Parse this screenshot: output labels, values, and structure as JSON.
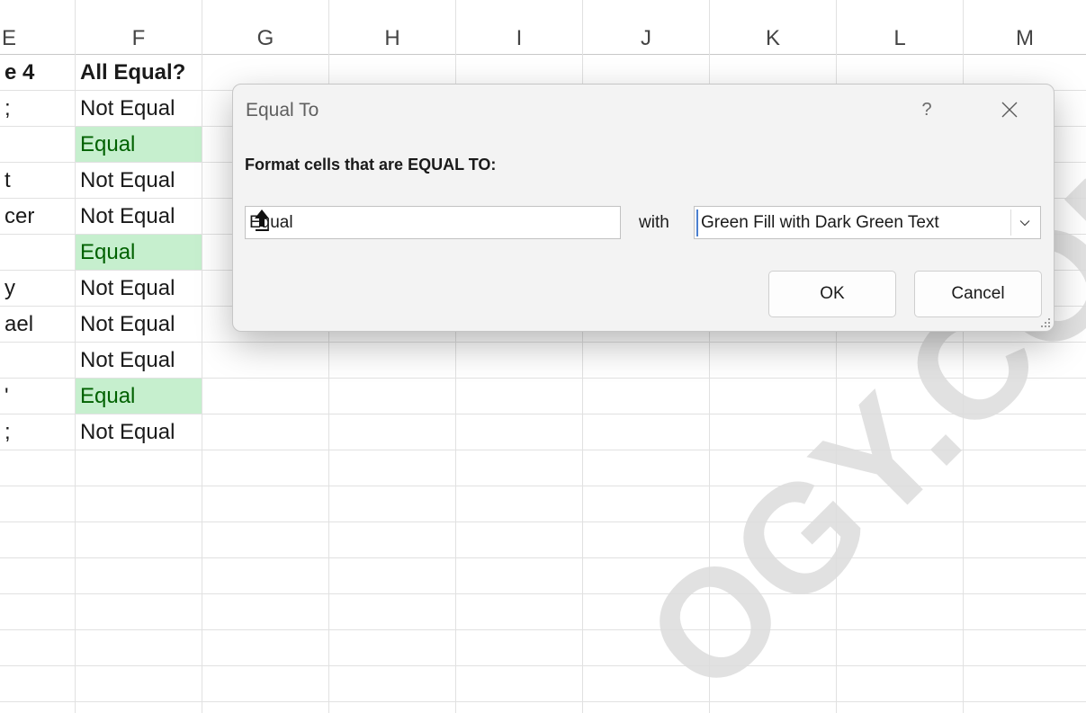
{
  "sheet": {
    "columns": [
      "E",
      "F",
      "G",
      "H",
      "I",
      "J",
      "K",
      "L",
      "M"
    ],
    "col_e_cells": [
      "e 4",
      ";",
      "",
      "t",
      "cer",
      "",
      "y",
      "ael",
      "",
      "'",
      ";"
    ],
    "col_f_header": "All Equal?",
    "col_f_cells": [
      "Not Equal",
      "Equal",
      "Not Equal",
      "Not Equal",
      "Equal",
      "Not Equal",
      "Not Equal",
      "Not Equal",
      "Equal",
      "Not Equal"
    ]
  },
  "dialog": {
    "title": "Equal To",
    "help_label": "?",
    "prompt": "Format cells that are EQUAL TO:",
    "value": "Equal",
    "with_label": "with",
    "format_option": "Green Fill with Dark Green Text",
    "ok_label": "OK",
    "cancel_label": "Cancel"
  },
  "watermark": "OGY.COM",
  "colors": {
    "equal_fill": "#c6efce",
    "equal_text": "#006100",
    "watermark": "#dcdcdc"
  }
}
